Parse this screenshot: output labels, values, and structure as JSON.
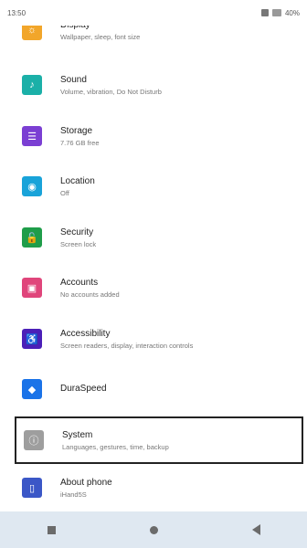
{
  "status": {
    "time": "13:50",
    "right": "40%"
  },
  "items": [
    {
      "title": "Display",
      "subtitle": "Wallpaper, sleep, font size",
      "color": "#f2a62a",
      "icon": "display-icon",
      "glyph": "☼"
    },
    {
      "title": "Sound",
      "subtitle": "Volume, vibration, Do Not Disturb",
      "color": "#1bb0a8",
      "icon": "sound-icon",
      "glyph": "♪"
    },
    {
      "title": "Storage",
      "subtitle": "7.76 GB free",
      "color": "#7b3fd3",
      "icon": "storage-icon",
      "glyph": "☰"
    },
    {
      "title": "Location",
      "subtitle": "Off",
      "color": "#19a3d9",
      "icon": "location-icon",
      "glyph": "◉"
    },
    {
      "title": "Security",
      "subtitle": "Screen lock",
      "color": "#1f9d4a",
      "icon": "lock-icon",
      "glyph": "🔓"
    },
    {
      "title": "Accounts",
      "subtitle": "No accounts added",
      "color": "#e0457b",
      "icon": "accounts-icon",
      "glyph": "▣"
    },
    {
      "title": "Accessibility",
      "subtitle": "Screen readers, display, interaction controls",
      "color": "#4b1fb8",
      "icon": "accessibility-icon",
      "glyph": "♿"
    },
    {
      "title": "DuraSpeed",
      "subtitle": "",
      "color": "#1a73e8",
      "icon": "duraspeed-icon",
      "glyph": "◆"
    },
    {
      "title": "System",
      "subtitle": "Languages, gestures, time, backup",
      "color": "#9e9e9e",
      "icon": "system-icon",
      "glyph": "ⓘ"
    },
    {
      "title": "About phone",
      "subtitle": "iHand5S",
      "color": "#3b57c7",
      "icon": "about-phone-icon",
      "glyph": "▯"
    }
  ],
  "nav": {
    "recents": "recents-icon",
    "home": "home-icon",
    "back": "back-icon"
  }
}
